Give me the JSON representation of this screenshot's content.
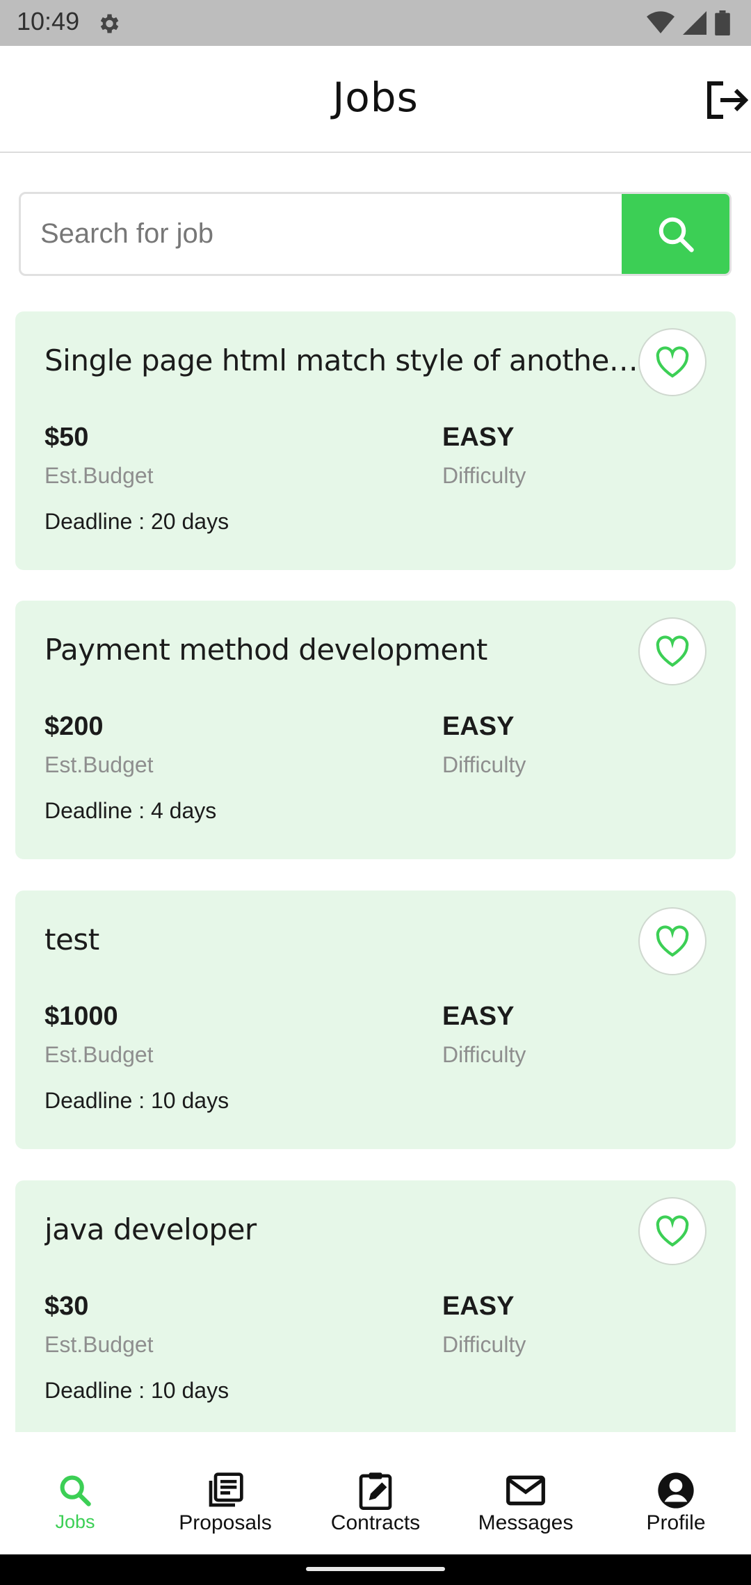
{
  "status_bar": {
    "time": "10:49"
  },
  "app_bar": {
    "title": "Jobs"
  },
  "search": {
    "placeholder": "Search for job"
  },
  "jobs": [
    {
      "title": "Single page html match style of another site",
      "budget": "$50",
      "budget_label": "Est.Budget",
      "difficulty": "EASY",
      "difficulty_label": "Difficulty",
      "deadline": "Deadline : 20 days"
    },
    {
      "title": "Payment method development",
      "budget": "$200",
      "budget_label": "Est.Budget",
      "difficulty": "EASY",
      "difficulty_label": "Difficulty",
      "deadline": "Deadline : 4 days"
    },
    {
      "title": "test",
      "budget": "$1000",
      "budget_label": "Est.Budget",
      "difficulty": "EASY",
      "difficulty_label": "Difficulty",
      "deadline": "Deadline : 10 days"
    },
    {
      "title": "java developer",
      "budget": "$30",
      "budget_label": "Est.Budget",
      "difficulty": "EASY",
      "difficulty_label": "Difficulty",
      "deadline": "Deadline : 10 days"
    }
  ],
  "bottom_nav": [
    {
      "label": "Jobs",
      "icon": "search-icon",
      "active": true
    },
    {
      "label": "Proposals",
      "icon": "proposals-icon",
      "active": false
    },
    {
      "label": "Contracts",
      "icon": "contracts-icon",
      "active": false
    },
    {
      "label": "Messages",
      "icon": "mail-icon",
      "active": false
    },
    {
      "label": "Profile",
      "icon": "profile-icon",
      "active": false
    }
  ],
  "colors": {
    "accent": "#3ccf55",
    "card_bg": "#e6f7e8"
  }
}
